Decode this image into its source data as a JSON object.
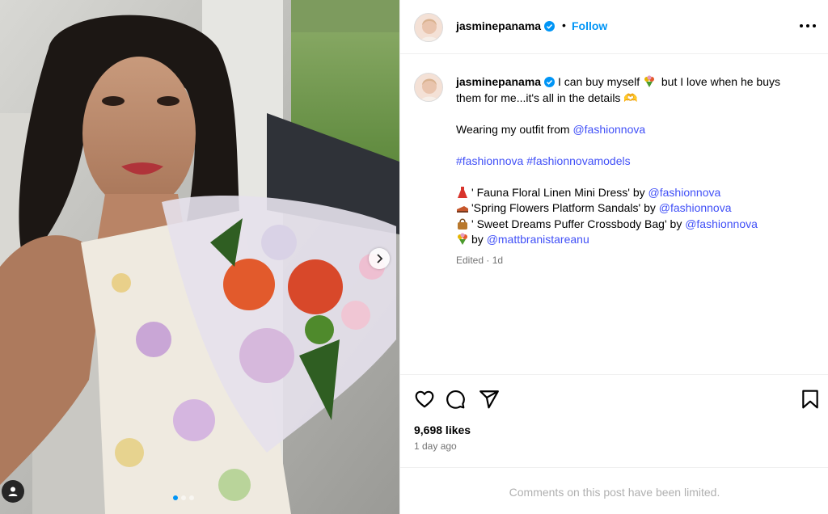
{
  "author": {
    "username": "jasminepanama",
    "follow_label": "Follow",
    "separator": "•"
  },
  "caption": {
    "line1": "I can buy myself",
    "line1b": "but I love when he buys",
    "line2": "them for me...it's all in the details 🫶",
    "wearing_prefix": "Wearing my outfit from",
    "wearing_handle": "@fashionnova",
    "hashtag1": "#fashionnova",
    "hashtag2": "#fashionnovamodels",
    "items": [
      {
        "icon": "dress-icon",
        "text": "' Fauna Floral Linen Mini Dress' by",
        "handle": "@fashionnova"
      },
      {
        "icon": "sandal-icon",
        "text": "'Spring Flowers Platform Sandals' by",
        "handle": "@fashionnova"
      },
      {
        "icon": "handbag-icon",
        "text": "' Sweet Dreams Puffer Crossbody Bag' by",
        "handle": "@fashionnova"
      },
      {
        "icon": "bouquet-icon",
        "text": "by",
        "handle": "@mattbranistareanu"
      }
    ],
    "edited": "Edited · 1d"
  },
  "stats": {
    "likes": "9,698 likes",
    "posted": "1 day ago"
  },
  "comments_notice": "Comments on this post have been limited.",
  "carousel": {
    "slides": 3,
    "active": 1
  },
  "colors": {
    "accent": "#0095f6",
    "link": "#4150f7",
    "muted": "#737373",
    "divider": "#efefef"
  },
  "icons": [
    "verified-badge-icon",
    "more-options-icon",
    "heart-icon",
    "comment-icon",
    "share-icon",
    "bookmark-icon",
    "next-arrow-icon",
    "user-tag-icon"
  ]
}
